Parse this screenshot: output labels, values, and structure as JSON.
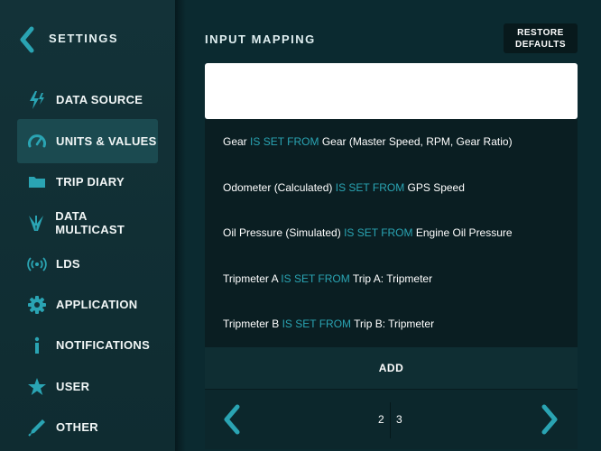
{
  "sidebar": {
    "title": "SETTINGS",
    "items": [
      {
        "label": "DATA SOURCE",
        "icon": "lightning-icon",
        "active": false
      },
      {
        "label": "UNITS & VALUES",
        "icon": "gauge-icon",
        "active": true
      },
      {
        "label": "TRIP DIARY",
        "icon": "folder-icon",
        "active": false
      },
      {
        "label": "DATA MULTICAST",
        "icon": "multicast-icon",
        "active": false
      },
      {
        "label": "LDS",
        "icon": "broadcast-icon",
        "active": false
      },
      {
        "label": "APPLICATION",
        "icon": "gear-icon",
        "active": false
      },
      {
        "label": "NOTIFICATIONS",
        "icon": "info-icon",
        "active": false
      },
      {
        "label": "USER",
        "icon": "star-icon",
        "active": false
      },
      {
        "label": "OTHER",
        "icon": "pen-icon",
        "active": false
      }
    ]
  },
  "main": {
    "title": "INPUT MAPPING",
    "restore_label_line1": "RESTORE",
    "restore_label_line2": "DEFAULTS",
    "search": {
      "value": "",
      "placeholder": ""
    },
    "mappings": [
      {
        "target": "Gear",
        "keyword": "IS SET FROM",
        "source": "Gear (Master Speed, RPM, Gear Ratio)"
      },
      {
        "target": "Odometer (Calculated)",
        "keyword": "IS SET FROM",
        "source": "GPS Speed"
      },
      {
        "target": "Oil Pressure (Simulated)",
        "keyword": "IS SET FROM",
        "source": "Engine Oil Pressure"
      },
      {
        "target": "Tripmeter A",
        "keyword": "IS SET FROM",
        "source": "Trip A: Tripmeter"
      },
      {
        "target": "Tripmeter B",
        "keyword": "IS SET FROM",
        "source": "Trip B: Tripmeter"
      }
    ],
    "add_label": "ADD",
    "pager": {
      "page_a": "2",
      "page_b": "3"
    }
  },
  "colors": {
    "accent": "#2aa4b3",
    "background": "#0b2a30",
    "active_item": "#1b4a50"
  }
}
